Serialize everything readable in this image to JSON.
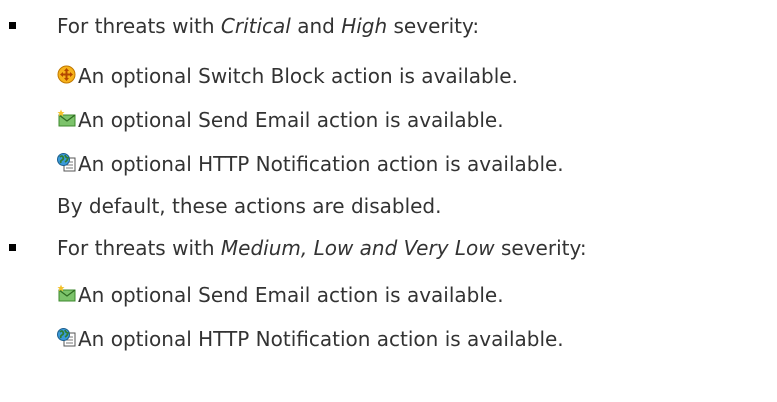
{
  "sections": [
    {
      "lead": "For threats with ",
      "emph1": "Critical",
      "middle": " and ",
      "emph2": "High",
      "tail": " severity:",
      "actions": [
        {
          "icon": "switch-block-icon",
          "text": "An optional Switch Block action is available."
        },
        {
          "icon": "send-email-icon",
          "text": "An optional Send Email action is available."
        },
        {
          "icon": "http-notification-icon",
          "text": "An optional HTTP Notification action is available."
        }
      ],
      "note": "By default, these actions are disabled."
    },
    {
      "lead": "For threats with ",
      "emph1": "Medium, Low and Very Low",
      "tail": " severity:",
      "actions": [
        {
          "icon": "send-email-icon",
          "text": "An optional Send Email action is available."
        },
        {
          "icon": "http-notification-icon",
          "text": "An optional HTTP Notification action is available."
        }
      ]
    }
  ],
  "colors": {
    "text": "#333333",
    "bullet": "#000000",
    "switch_icon": "#f0a000",
    "email_icon": "#4caf50",
    "http_icon": "#2e7d32"
  }
}
